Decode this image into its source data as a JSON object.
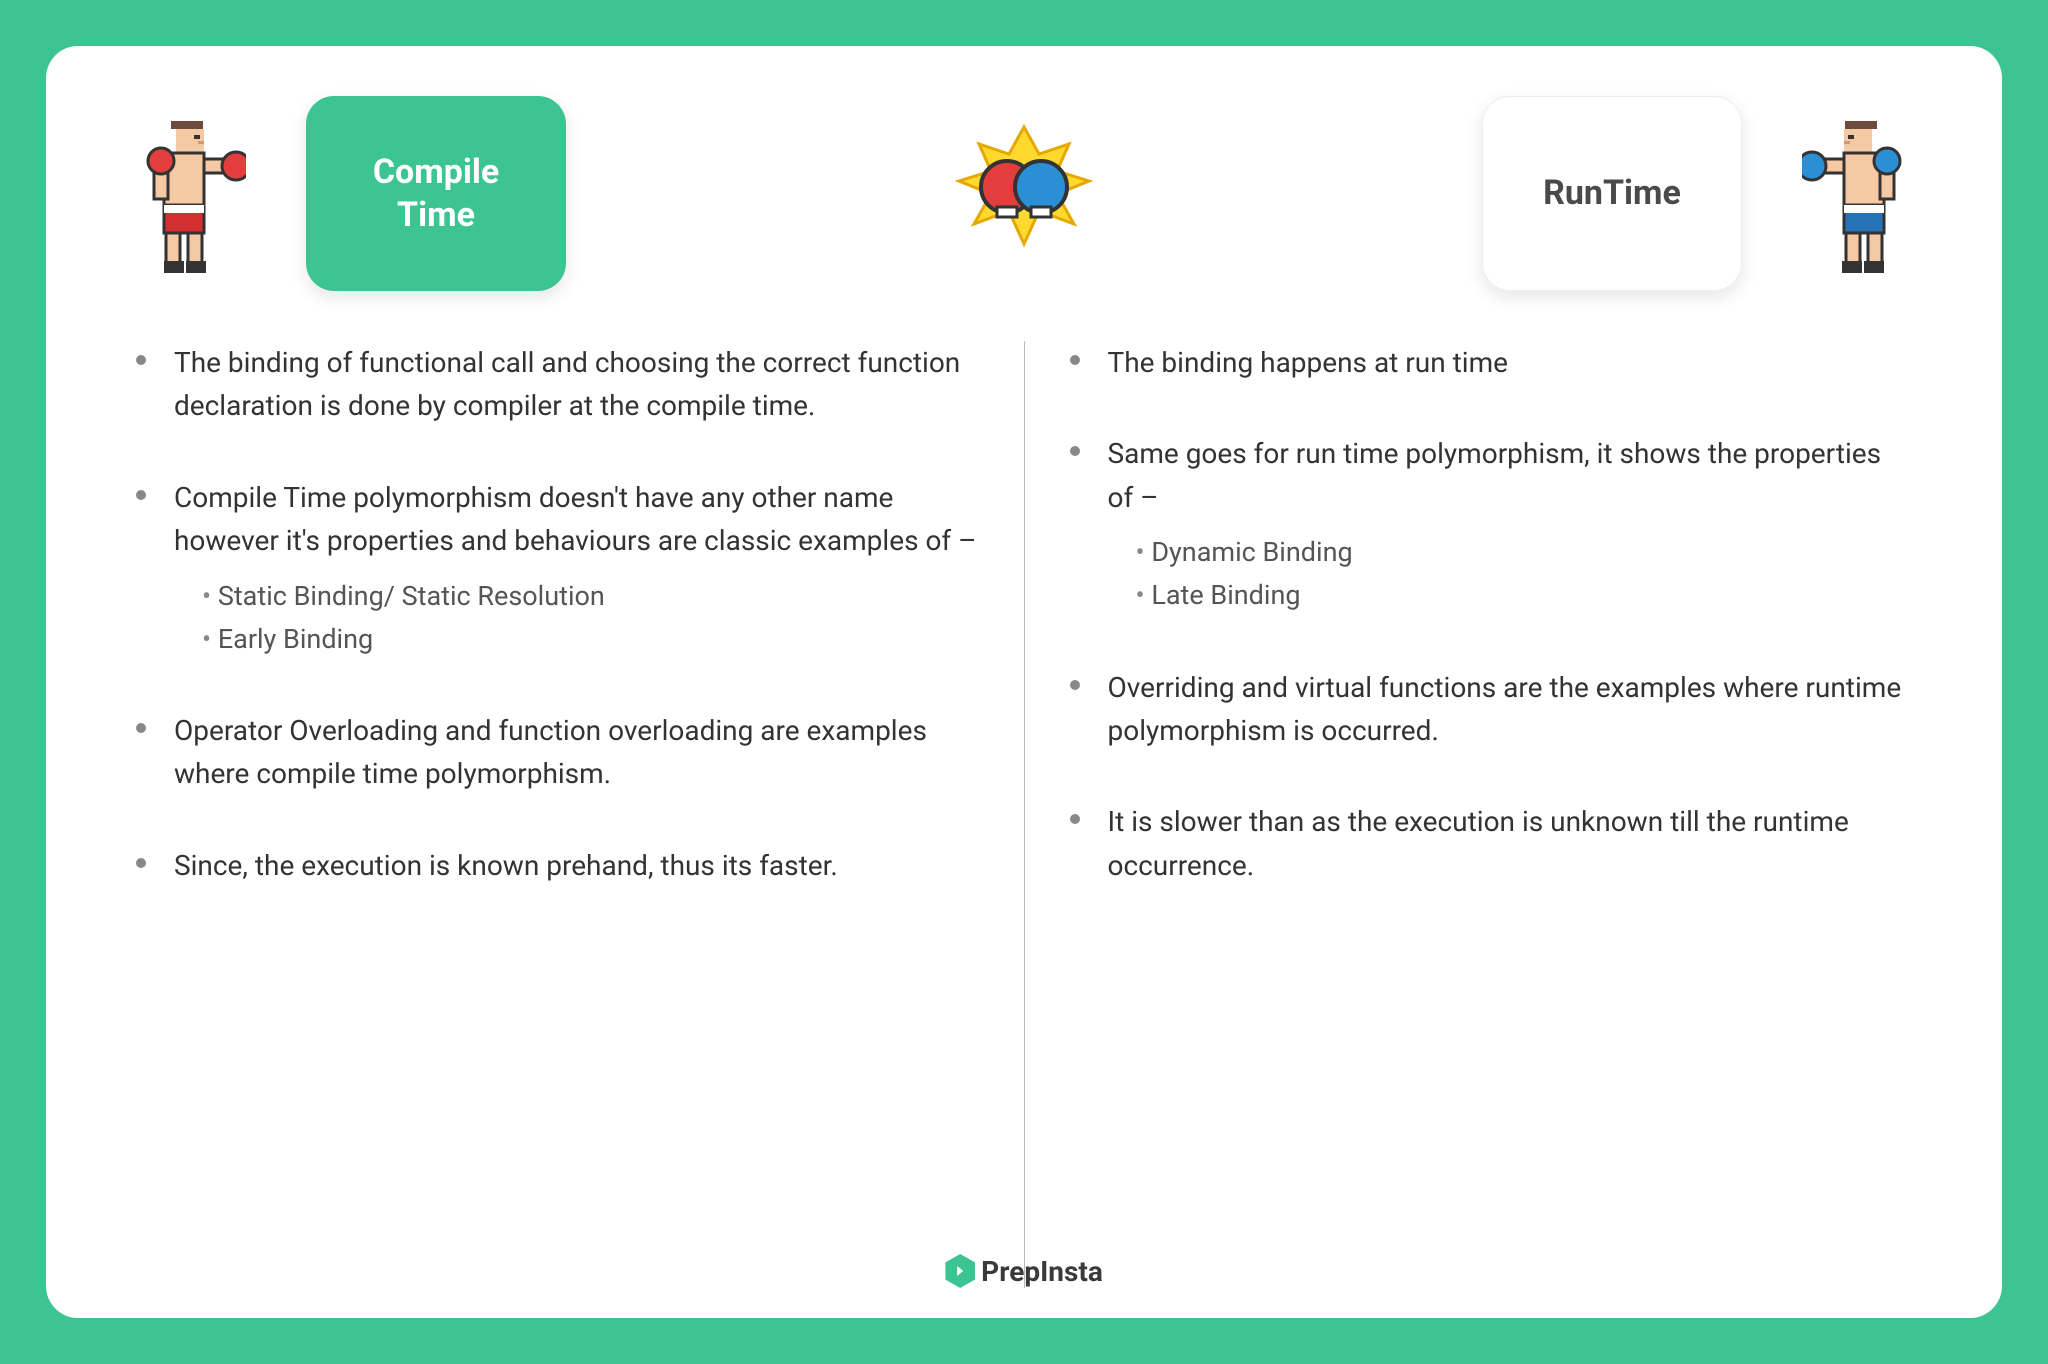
{
  "left": {
    "title": "Compile\nTime",
    "points": [
      {
        "text": "The binding of functional call and choosing the correct function declaration is done by compiler at the compile time."
      },
      {
        "text": "Compile Time polymorphism doesn't have any other name however it's properties and behaviours are classic examples of –",
        "sub": [
          "Static Binding/ Static Resolution",
          "Early Binding"
        ]
      },
      {
        "text": "Operator Overloading and function overloading are examples where compile time polymorphism."
      },
      {
        "text": "Since, the execution is known prehand, thus its faster."
      }
    ]
  },
  "right": {
    "title": "RunTime",
    "points": [
      {
        "text": "The binding happens at run time"
      },
      {
        "text": "Same goes for run time polymorphism, it shows the properties of –",
        "sub": [
          "Dynamic Binding",
          "Late Binding"
        ]
      },
      {
        "text": "Overriding and virtual functions are the examples where runtime polymorphism is occurred."
      },
      {
        "text": "It is slower than as the execution is unknown till the runtime occurrence."
      }
    ]
  },
  "footer": {
    "brand": "PrepInsta"
  }
}
